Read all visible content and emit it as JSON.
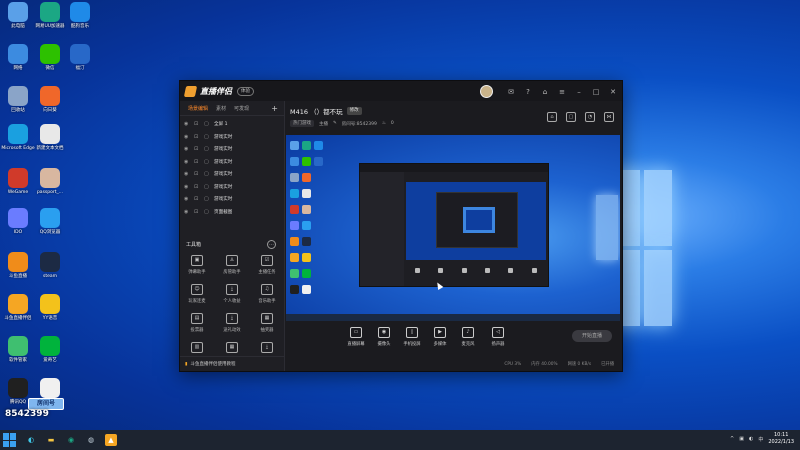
{
  "desktop": {
    "icons": [
      {
        "label": "此电脑",
        "color": "#5aa0e8"
      },
      {
        "label": "网易UU加速器",
        "color": "#1ba784"
      },
      {
        "label": "酷狗音乐",
        "color": "#1f8ae8"
      },
      {
        "label": "网络",
        "color": "#3c8be0"
      },
      {
        "label": "微信",
        "color": "#2dc100"
      },
      {
        "label": "福汀",
        "color": "#2868c8"
      },
      {
        "label": "回收站",
        "color": "#8aa4c8"
      },
      {
        "label": "向日葵",
        "color": "#f0672a"
      },
      {
        "label": "Microsoft Edge",
        "color": "#1aa0e0"
      },
      {
        "label": "新建文本文档",
        "color": "#e8e8e8"
      },
      {
        "label": "WeGame",
        "color": "#d03a2a"
      },
      {
        "label": "passport_...",
        "color": "#d8b7a0"
      },
      {
        "label": "IDO",
        "color": "#6a7cff"
      },
      {
        "label": "QQ浏览器",
        "color": "#2a9ff0"
      },
      {
        "label": "斗鱼直播",
        "color": "#f08c1a"
      },
      {
        "label": "steam",
        "color": "#1c2a44"
      },
      {
        "label": "斗鱼直播伴侣",
        "color": "#f5a623"
      },
      {
        "label": "YY语音",
        "color": "#f3c21b"
      },
      {
        "label": "软件管家",
        "color": "#3fbf70"
      },
      {
        "label": "爱奇艺",
        "color": "#00b33c"
      },
      {
        "label": "腾讯QQ",
        "color": "#202020"
      },
      {
        "label": "",
        "color": "#f0f0f0"
      }
    ]
  },
  "overlay": {
    "id_label": "房间号",
    "id_number": "8542399"
  },
  "app": {
    "title": "直播伴侣",
    "badge": "体验",
    "left_tabs": [
      "场景编辑",
      "素材",
      "可发现"
    ],
    "add_label": "+",
    "scenes": [
      "全屏 1",
      "游戏实时",
      "游戏实时",
      "游戏实时",
      "游戏实时",
      "游戏实时",
      "游戏实时",
      "页面截图"
    ],
    "tools_title": "工具箱",
    "tools": [
      {
        "label": "弹幕助手",
        "icon": "▣",
        "red": false
      },
      {
        "label": "房管助手",
        "icon": "♙",
        "red": false
      },
      {
        "label": "主播任务",
        "icon": "☑",
        "red": false
      },
      {
        "label": "玩家连麦",
        "icon": "☺",
        "red": false
      },
      {
        "label": "个人收益",
        "icon": "⤓",
        "red": false
      },
      {
        "label": "音乐助手",
        "icon": "♫",
        "red": false
      },
      {
        "label": "投票器",
        "icon": "▤",
        "red": false
      },
      {
        "label": "送礼动效",
        "icon": "⤓",
        "red": false
      },
      {
        "label": "抽奖器",
        "icon": "▦",
        "red": false
      },
      {
        "label": "",
        "icon": "▥",
        "red": false
      },
      {
        "label": "",
        "icon": "▦",
        "red": true
      },
      {
        "label": "",
        "icon": "⤓",
        "red": false
      }
    ],
    "notice": "斗鱼直播伴侣使用教程",
    "room_title": "M416 （）都不玩",
    "room_tag": "修改",
    "meta": {
      "category": "热门游戏",
      "sub": "主播",
      "room_id_label": "房间号:8542399",
      "heat": "0"
    },
    "controls": [
      {
        "label": "直播屏幕",
        "icon": "▭"
      },
      {
        "label": "摄像头",
        "icon": "◉"
      },
      {
        "label": "手机投屏",
        "icon": "▯"
      },
      {
        "label": "多媒体",
        "icon": "▶"
      },
      {
        "label": "麦克风",
        "icon": "♪"
      },
      {
        "label": "扬声器",
        "icon": "◁"
      }
    ],
    "go_live": "开始直播",
    "status": [
      "CPU 3%",
      "内存 40.00%",
      "网速 0 KB/s",
      "已开播"
    ]
  },
  "taskbar": {
    "time": "10:11",
    "date": "2022/1/13",
    "tray": [
      "^",
      "▣",
      "◐",
      "中"
    ]
  }
}
